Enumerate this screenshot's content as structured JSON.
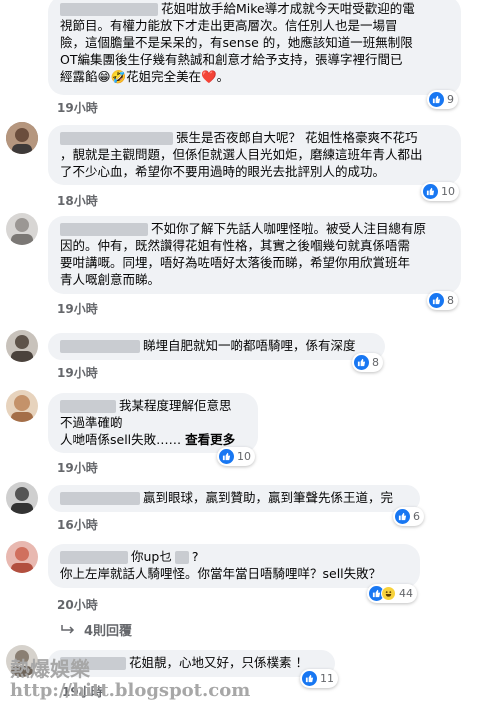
{
  "comments": [
    {
      "lines": [
        "花姐咁放手給Mike導才成就今天咁受歡迎的電",
        "視節目。有權力能放下才走出更高層次。信任別人也是一場冒",
        "險，這個膽量不是呆呆的，有sense 的，她應該知道一班無制限",
        "OT編集團後生仔幾有熱誠和創意才給予支持，張導字裡行間已",
        "經露餡😁🤣花姐完全美在❤️。"
      ],
      "time": "19小時",
      "likes": "9"
    },
    {
      "lines": [
        "張生是否夜郎自大呢？ 花姐性格豪爽不花巧",
        "，靚就是主觀問題，但係佢就選人目光如炬，磨練這班年青人都出",
        "了不少心血，希望你不要用過時的眼光去批評別人的成功。"
      ],
      "time": "18小時",
      "likes": "10"
    },
    {
      "lines": [
        "不如你了解下先話人咖哩怪啦。被受人注目總有原",
        "因的。仲有，既然讚得花姐有性格，其實之後嗰幾句就真係唔需",
        "要咁講嘅。同埋，唔好為咗唔好太落後而睇，希望你用欣賞班年",
        "青人嘅創意而睇。"
      ],
      "time": "19小時",
      "likes": "8"
    },
    {
      "lines": [
        "睇埋自肥就知一啲都唔騎哩，係有深度"
      ],
      "time": "19小時",
      "likes": "8"
    },
    {
      "lines": [
        "我某程度理解佢意思",
        "不過準確啲",
        "人哋唔係sell失敗……"
      ],
      "see_more": "查看更多",
      "time": "19小時",
      "likes": "10"
    },
    {
      "lines": [
        "贏到眼球，贏到贊助，贏到筆聲先係王道，完"
      ],
      "time": "16小時",
      "likes": "6"
    },
    {
      "lines": [
        "你up乜",
        "你上左岸就話人騎哩怪。你當年當日唔騎哩咩？sell失敗？"
      ],
      "marker": "?",
      "time": "20小時",
      "likes": "44"
    },
    {
      "lines": [
        "花姐靚，心地又好，只係樸素 ！"
      ],
      "time": "19小時",
      "likes": "11"
    }
  ],
  "replies_label": "4則回覆",
  "watermark": {
    "title": "熱爆娛樂",
    "url": "http://hitt.blogspot.com"
  },
  "colors": {
    "bubble": "#f0f2f5",
    "like": "#1877f2",
    "meta": "#65676b"
  }
}
